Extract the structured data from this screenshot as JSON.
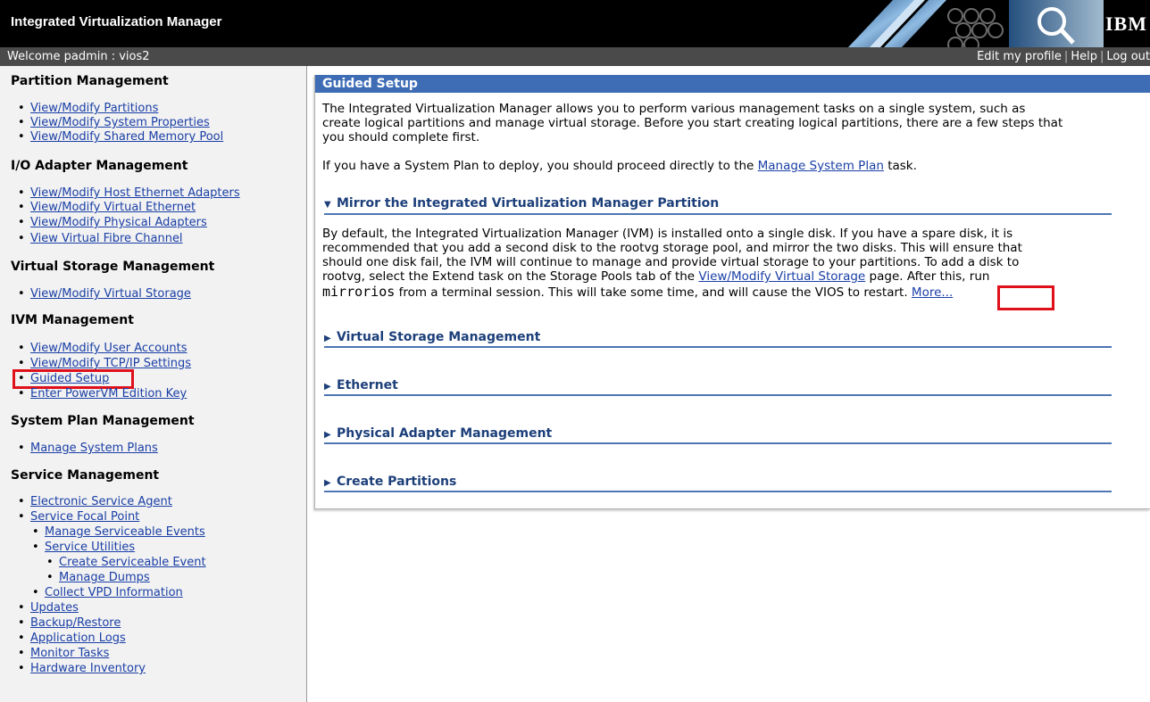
{
  "header": {
    "app_title": "Integrated Virtualization Manager",
    "logo_text": "IBM",
    "welcome": "Welcome padmin : vios2",
    "links": [
      "Edit my profile",
      "Help",
      "Log out"
    ]
  },
  "sidebar": {
    "sections": [
      {
        "title": "Partition Management",
        "items": [
          "View/Modify Partitions",
          "View/Modify System Properties",
          "View/Modify Shared Memory Pool"
        ]
      },
      {
        "title": "I/O Adapter Management",
        "items": [
          "View/Modify Host Ethernet Adapters",
          "View/Modify Virtual Ethernet",
          "View/Modify Physical Adapters",
          "View Virtual Fibre Channel"
        ]
      },
      {
        "title": "Virtual Storage Management",
        "items": [
          "View/Modify Virtual Storage"
        ]
      },
      {
        "title": "IVM Management",
        "items": [
          "View/Modify User Accounts",
          "View/Modify TCP/IP Settings",
          "Guided Setup",
          "Enter PowerVM Edition Key"
        ]
      },
      {
        "title": "System Plan Management",
        "items": [
          "Manage System Plans"
        ]
      },
      {
        "title": "Service Management",
        "items": [
          "Electronic Service Agent",
          "Service Focal Point",
          "Manage Serviceable Events",
          "Service Utilities",
          "Create Serviceable Event",
          "Manage Dumps",
          "Collect VPD Information",
          "Updates",
          "Backup/Restore",
          "Application Logs",
          "Monitor Tasks",
          "Hardware Inventory"
        ]
      }
    ]
  },
  "main": {
    "panel_title": "Guided Setup",
    "intro_line1": "The Integrated Virtualization Manager allows you to perform various management tasks on a single system, such as",
    "intro_line2": "create logical partitions and manage virtual storage. Before you start creating logical partitions, there are a few steps that",
    "intro_line3": "you should complete first.",
    "plan_prefix": "If you have a System Plan to deploy, you should proceed directly to the ",
    "plan_link": "Manage System Plan",
    "plan_suffix": " task.",
    "mirror": {
      "title": "Mirror the Integrated Virtualization Manager Partition",
      "line1": "By default, the Integrated Virtualization Manager (IVM) is installed onto a single disk. If you have a spare disk, it is",
      "line2": "recommended that you add a second disk to the rootvg storage pool, and mirror the two disks. This will ensure that",
      "line3": "should one disk fail, the IVM will continue to manage and provide virtual storage to your partitions. To add a disk to",
      "line4_prefix": "rootvg, select the Extend task on the Storage Pools tab of the ",
      "line4_link": "View/Modify Virtual Storage",
      "line4_suffix": " page. After this, run",
      "line5_cmd": "mirrorios",
      "line5_text": " from a terminal session. This will take some time, and will cause the VIOS to restart.",
      "more_link": "More..."
    },
    "collapsed_sections": [
      "Virtual Storage Management",
      "Ethernet",
      "Physical Adapter Management",
      "Create Partitions"
    ]
  }
}
